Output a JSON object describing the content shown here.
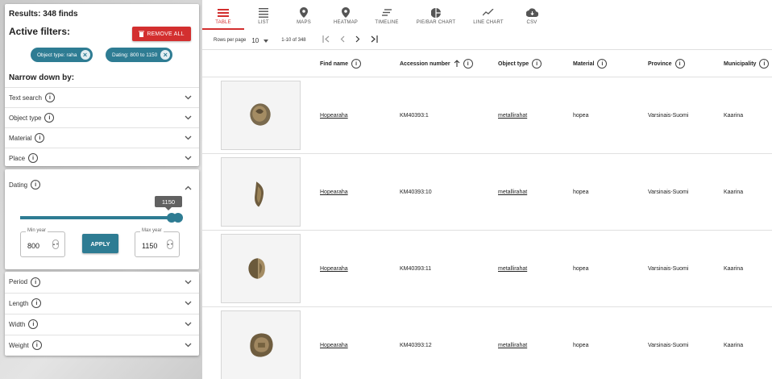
{
  "results": {
    "label": "Results: 348 finds"
  },
  "active_filters": {
    "title": "Active filters:",
    "remove_all_label": "REMOVE ALL",
    "chips": [
      {
        "label": "Object type: raha"
      },
      {
        "label": "Dating: 800 to 1150"
      }
    ]
  },
  "narrow": {
    "title": "Narrow down by:",
    "facets": [
      {
        "label": "Text search"
      },
      {
        "label": "Object type"
      },
      {
        "label": "Material"
      },
      {
        "label": "Place"
      }
    ]
  },
  "dating": {
    "label": "Dating",
    "slider_tooltip": "1150",
    "min_label": "Min year",
    "min_value": "800",
    "max_label": "Max year",
    "max_value": "1150",
    "apply_label": "APPLY",
    "range_fraction": [
      0.0,
      0.98
    ]
  },
  "more_facets": [
    {
      "label": "Period"
    },
    {
      "label": "Length"
    },
    {
      "label": "Width"
    },
    {
      "label": "Weight"
    }
  ],
  "tabs": [
    {
      "label": "TABLE",
      "icon": "table-icon",
      "active": true
    },
    {
      "label": "LIST",
      "icon": "list-icon"
    },
    {
      "label": "MAPS",
      "icon": "map-pin-icon"
    },
    {
      "label": "HEATMAP",
      "icon": "heatmap-pin-icon"
    },
    {
      "label": "TIMELINE",
      "icon": "timeline-icon"
    },
    {
      "label": "PIE/BAR CHART",
      "icon": "pie-chart-icon"
    },
    {
      "label": "LINE CHART",
      "icon": "line-chart-icon"
    },
    {
      "label": "CSV",
      "icon": "cloud-download-icon"
    }
  ],
  "pager": {
    "rows_label": "Rows per page",
    "rows_value": "10",
    "range": "1-10 of 348"
  },
  "table": {
    "headers": [
      "Find name",
      "Accession number",
      "Object type",
      "Material",
      "Province",
      "Municipality"
    ],
    "rows": [
      {
        "find_name": "Hopearaha",
        "accession": "KM40393:1",
        "object_type": "metallirahat",
        "material": "hopea",
        "province": "Varsinais-Suomi",
        "municipality": "Kaarina"
      },
      {
        "find_name": "Hopearaha",
        "accession": "KM40393:10",
        "object_type": "metallirahat",
        "material": "hopea",
        "province": "Varsinais-Suomi",
        "municipality": "Kaarina"
      },
      {
        "find_name": "Hopearaha",
        "accession": "KM40393:11",
        "object_type": "metallirahat",
        "material": "hopea",
        "province": "Varsinais-Suomi",
        "municipality": "Kaarina"
      },
      {
        "find_name": "Hopearaha",
        "accession": "KM40393:12",
        "object_type": "metallirahat",
        "material": "hopea",
        "province": "Varsinais-Suomi",
        "municipality": "Kaarina"
      }
    ]
  },
  "colors": {
    "accent": "#2e7c93",
    "danger": "#d32f2f"
  }
}
